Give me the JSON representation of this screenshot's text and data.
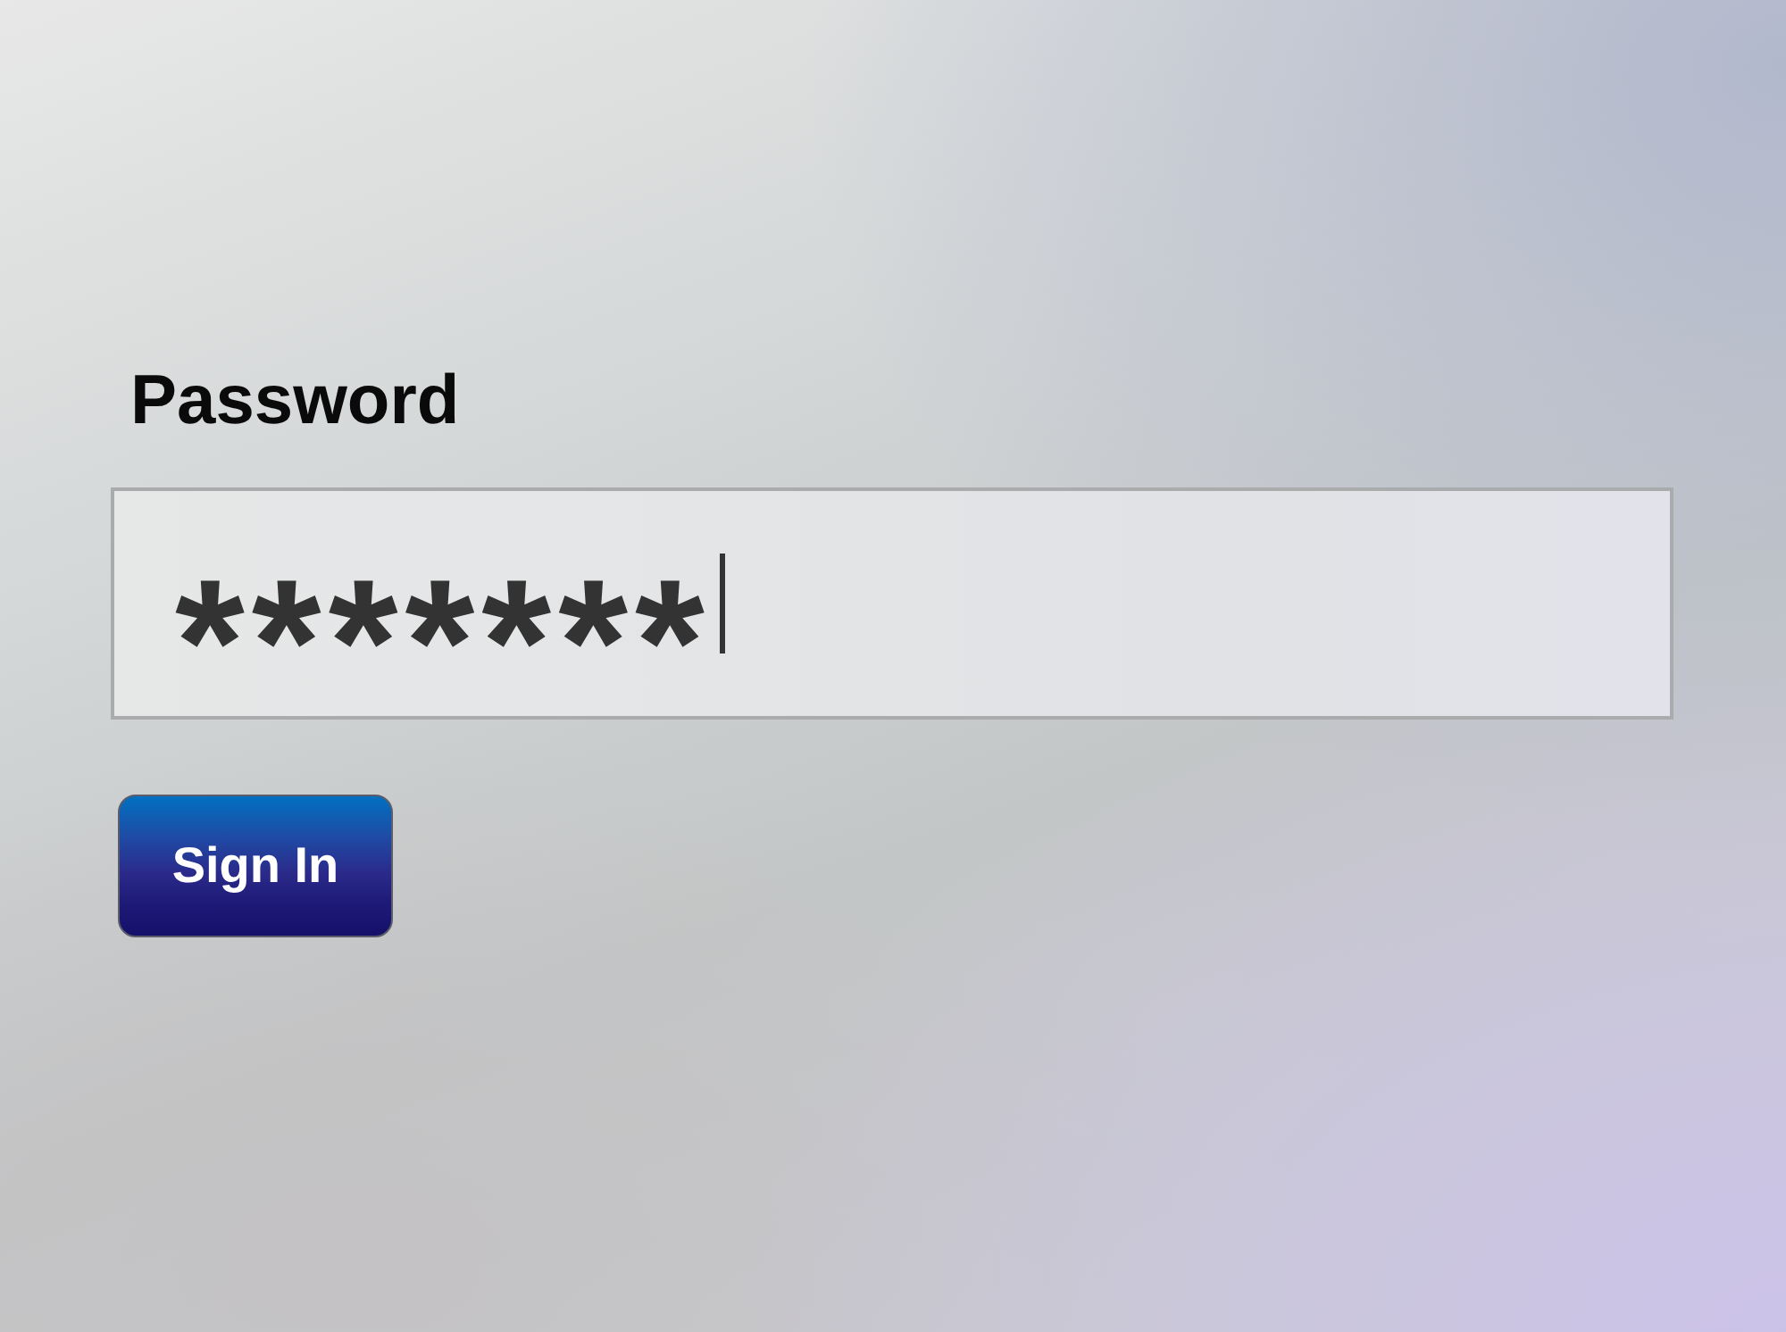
{
  "form": {
    "label": "Password",
    "password_field": {
      "value": "*******",
      "focused": true
    },
    "sign_in_button": {
      "label": "Sign In"
    }
  }
}
